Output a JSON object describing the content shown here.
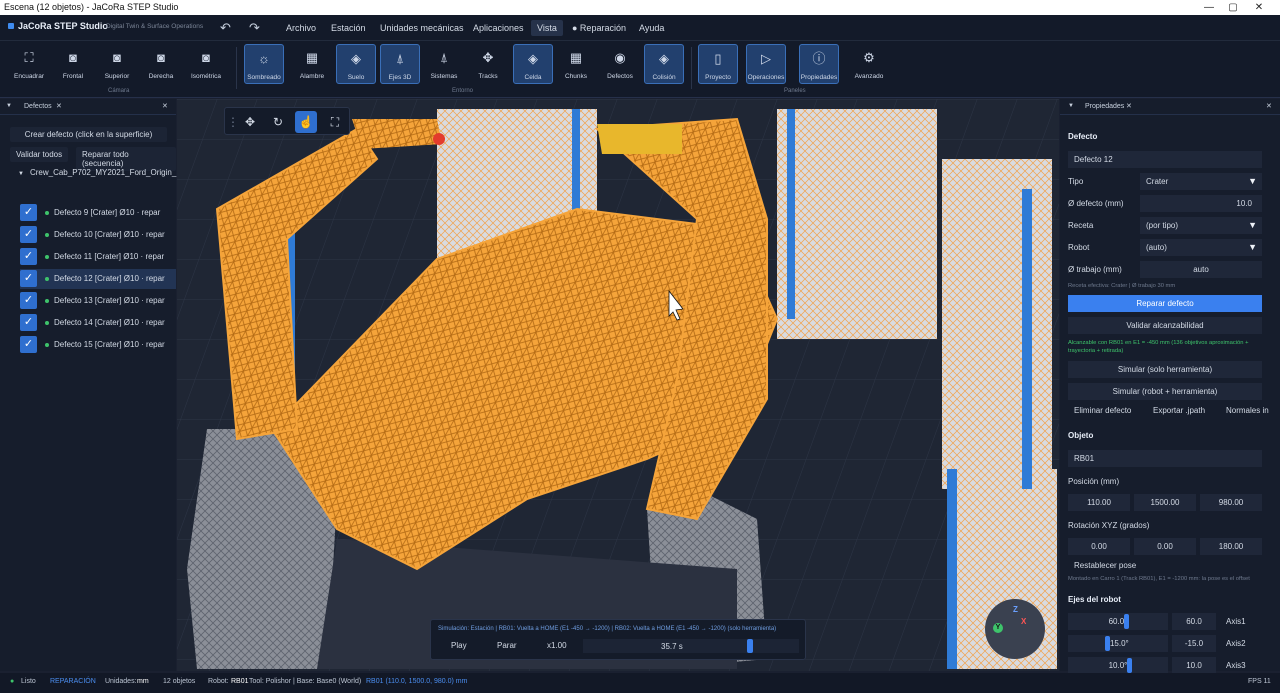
{
  "window": {
    "title": "Escena (12 objetos) - JaCoRa STEP Studio",
    "min": "—",
    "max": "▢",
    "close": "✕"
  },
  "app": {
    "name": "JaCoRa STEP Studio",
    "subtitle": "Digital Twin & Surface Operations"
  },
  "menu": [
    "Archivo",
    "Estación",
    "Unidades mecánicas",
    "Aplicaciones",
    "Vista",
    "● Reparación",
    "Ayuda"
  ],
  "toolbar": {
    "camera": {
      "group": "Cámara",
      "buttons": [
        {
          "label": "Encuadrar",
          "icon": "frame-icon"
        },
        {
          "label": "Frontal",
          "icon": "camera-icon"
        },
        {
          "label": "Superior",
          "icon": "camera-icon"
        },
        {
          "label": "Derecha",
          "icon": "camera-icon"
        },
        {
          "label": "Isométrica",
          "icon": "camera-icon"
        }
      ]
    },
    "entorno": {
      "group": "Entorno",
      "buttons": [
        {
          "label": "Sombreado",
          "icon": "sun-icon",
          "on": true
        },
        {
          "label": "Alambre",
          "icon": "grid-icon"
        },
        {
          "label": "Suelo",
          "icon": "layers-icon",
          "on": true
        },
        {
          "label": "Ejes 3D",
          "icon": "axes-icon",
          "on": true
        },
        {
          "label": "Sistemas",
          "icon": "frame-axes-icon"
        },
        {
          "label": "Tracks",
          "icon": "track-icon"
        },
        {
          "label": "Celda",
          "icon": "layers-icon",
          "on": true
        },
        {
          "label": "Chunks",
          "icon": "grid-icon"
        },
        {
          "label": "Defectos",
          "icon": "eye-icon"
        },
        {
          "label": "Colisión",
          "icon": "layers-icon",
          "on": true
        }
      ]
    },
    "paneles": {
      "group": "Paneles",
      "buttons": [
        {
          "label": "Proyecto",
          "icon": "panel-icon",
          "on": true
        },
        {
          "label": "Operaciones",
          "icon": "play-icon",
          "on": true
        },
        {
          "label": "Propiedades",
          "icon": "info-icon",
          "on": true
        },
        {
          "label": "Avanzado",
          "icon": "gear-icon"
        }
      ]
    }
  },
  "left_panel": {
    "tab": "Defectos",
    "create_btn": "Crear defecto (click en la superficie)",
    "validate_all": "Validar todos",
    "repair_all": "Reparar todo (secuencia)",
    "root": "Crew_Cab_P702_MY2021_Ford_Origin_",
    "items": [
      {
        "label": "Defecto 9  [Crater]  Ø10  · repar"
      },
      {
        "label": "Defecto 10  [Crater]  Ø10  · repar"
      },
      {
        "label": "Defecto 11  [Crater]  Ø10  · repar"
      },
      {
        "label": "Defecto 12  [Crater]  Ø10  · repar",
        "selected": true
      },
      {
        "label": "Defecto 13  [Crater]  Ø10  · repar"
      },
      {
        "label": "Defecto 14  [Crater]  Ø10  · repar"
      },
      {
        "label": "Defecto 15  [Crater]  Ø10  · repar"
      }
    ]
  },
  "simulation": {
    "info": "Simulación: Estación  |  RB01: Vuelta a HOME (E1 -450 → -1200)  |  RB02: Vuelta a HOME (E1 -450 → -1200)  (solo herramienta)",
    "play": "Play",
    "stop": "Parar",
    "speed": "x1.00",
    "time": "35.7 s",
    "progress": 0.78
  },
  "gizmo": {
    "z": "Z",
    "x": "X",
    "y": "Y"
  },
  "right_panel": {
    "tab": "Propiedades",
    "defect_section": "Defecto",
    "defect_name": "Defecto 12",
    "tipo_label": "Tipo",
    "tipo_value": "Crater",
    "diam_label": "Ø defecto (mm)",
    "diam_value": "10.0",
    "receta_label": "Receta",
    "receta_value": "(por tipo)",
    "robot_label": "Robot",
    "robot_value": "(auto)",
    "trabajo_label": "Ø trabajo (mm)",
    "trabajo_value": "auto",
    "receta_note": "Receta efectiva: Crater | Ø trabajo 30 mm",
    "repair_btn": "Reparar defecto",
    "validate_btn": "Validar alcanzabilidad",
    "reach_note": "Alcanzable con RB01 en E1 = -450 mm (136 objetivos aproximación + trayectoria + retirada)",
    "sim_tool_btn": "Simular (solo herramienta)",
    "sim_robot_btn": "Simular (robot + herramienta)",
    "delete_btn": "Eliminar defecto",
    "export_btn": "Exportar .jpath",
    "normals_btn": "Normales in",
    "object_section": "Objeto",
    "object_name": "RB01",
    "pos_label": "Posición (mm)",
    "pos": [
      "110.00",
      "1500.00",
      "980.00"
    ],
    "rot_label": "Rotación XYZ (grados)",
    "rot": [
      "0.00",
      "0.00",
      "180.00"
    ],
    "reset_btn": "Restablecer pose",
    "mount_note": "Montado en Carro 1 (Track RB01), E1 = -1200 mm: la pose es el offset",
    "axes_section": "Ejes del robot",
    "axes": [
      {
        "slider": "60.0°",
        "value": "60.0",
        "name": "Axis1",
        "pos": 0.75
      },
      {
        "slider": "-15.0°",
        "value": "-15.0",
        "name": "Axis2",
        "pos": 0.45
      },
      {
        "slider": "10.0°",
        "value": "10.0",
        "name": "Axis3",
        "pos": 0.8
      }
    ]
  },
  "status": {
    "ready": "Listo",
    "mode": "REPARACIÓN",
    "units_label": "Unidades:",
    "units": "mm",
    "objects": "12 objetos",
    "robot_label": "Robot:",
    "robot": "RB01",
    "tool": "Tool: Polishor | Base: Base0 (World)",
    "robot_pos": "RB01  (110.0, 1500.0, 980.0) mm",
    "fps": "FPS 11"
  },
  "colors": {
    "accent": "#3a80ef",
    "wireframe": "#f5a43a",
    "ok": "#3ec46b",
    "bg": "#161d2c"
  }
}
